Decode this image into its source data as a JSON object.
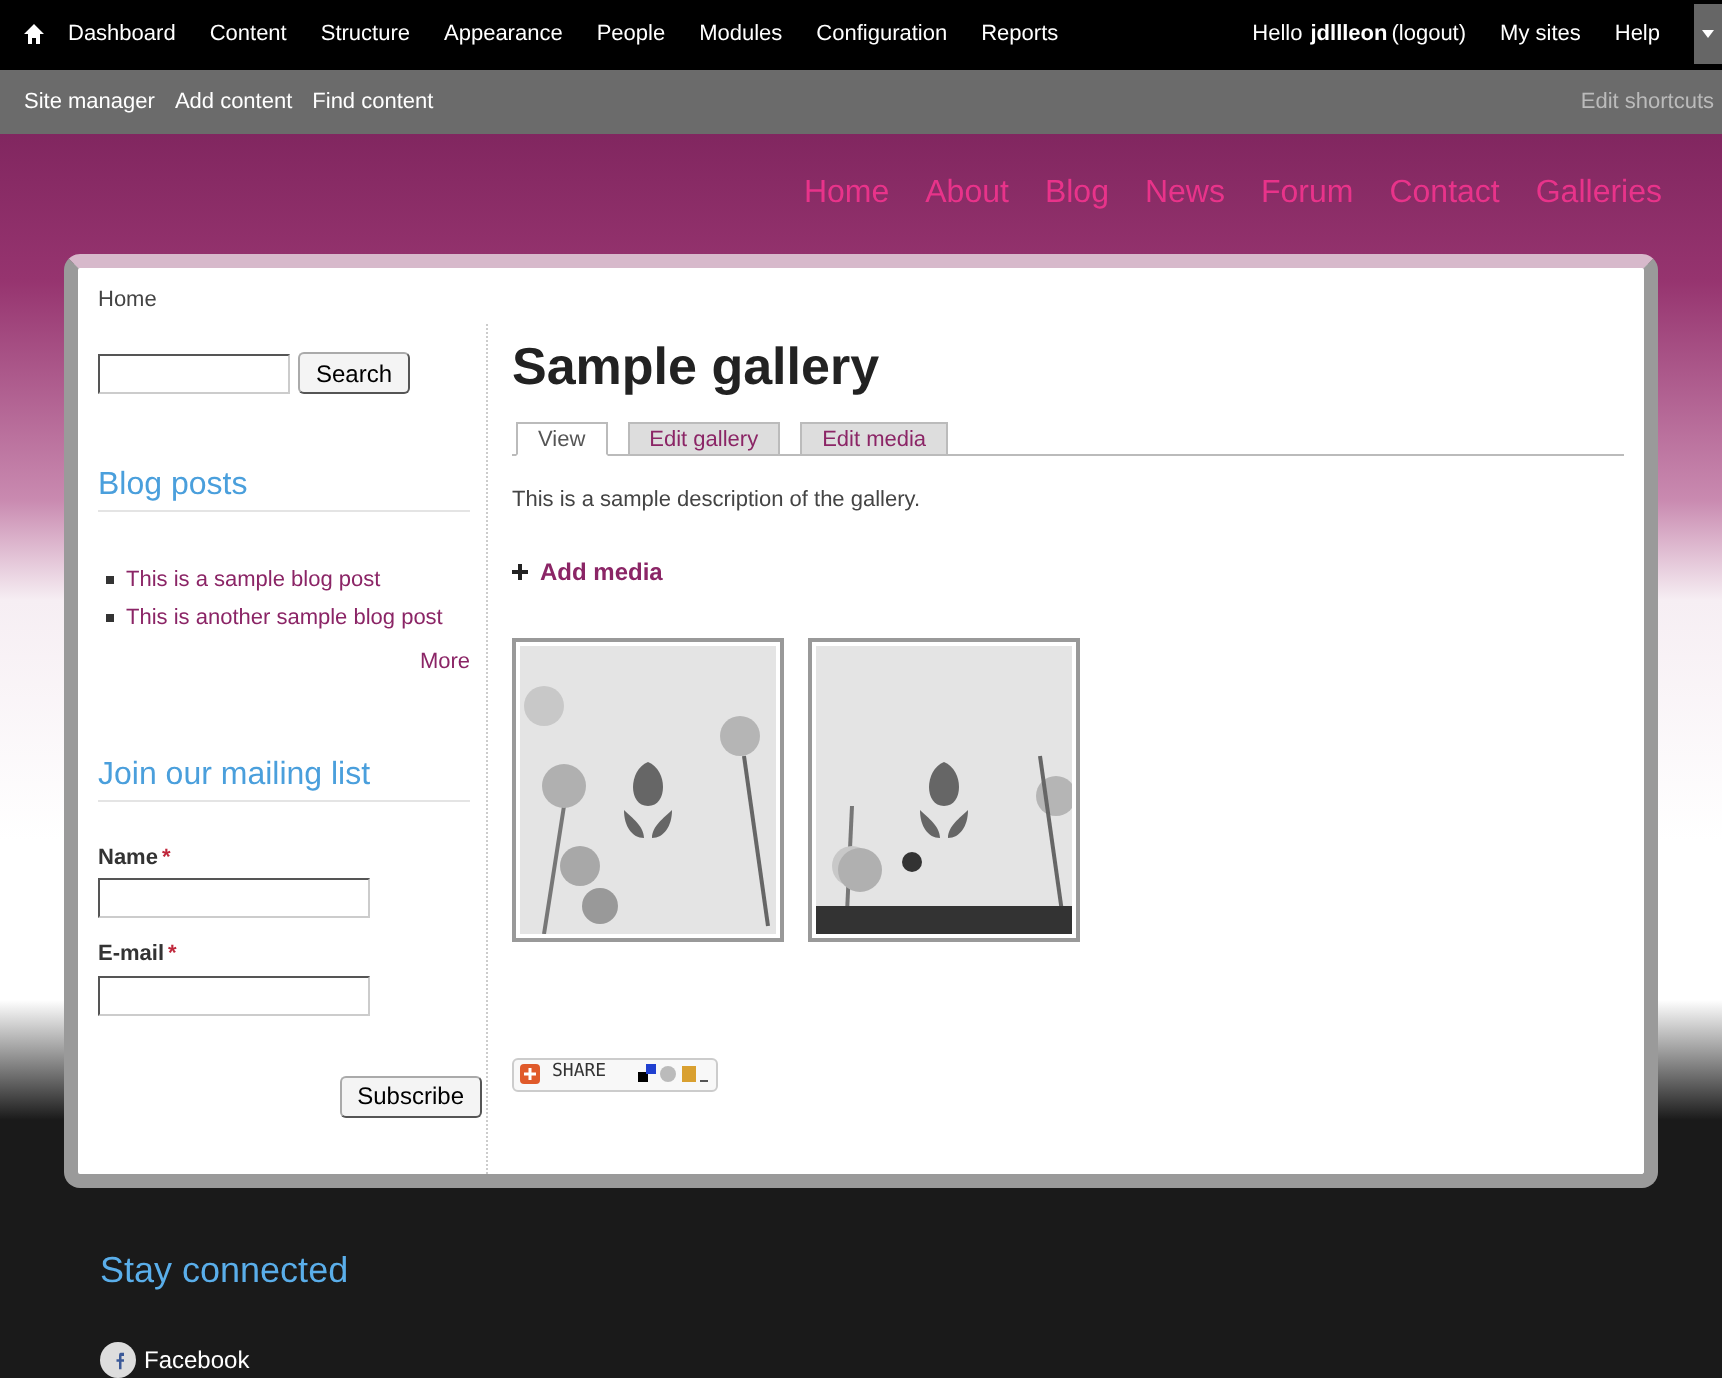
{
  "toolbar": {
    "menu": [
      "Dashboard",
      "Content",
      "Structure",
      "Appearance",
      "People",
      "Modules",
      "Configuration",
      "Reports"
    ],
    "greeting": "Hello",
    "username": "jdllleon",
    "logout": "(logout)",
    "links": [
      "My sites",
      "Help"
    ]
  },
  "shortcuts": {
    "items": [
      "Site manager",
      "Add content",
      "Find content"
    ],
    "edit": "Edit shortcuts"
  },
  "nav": [
    "Home",
    "About",
    "Blog",
    "News",
    "Forum",
    "Contact",
    "Galleries"
  ],
  "breadcrumb": "Home",
  "search": {
    "button": "Search"
  },
  "blog_block": {
    "title": "Blog posts",
    "items": [
      "This is a sample blog post",
      "This is another sample blog post"
    ],
    "more": "More"
  },
  "mailing_block": {
    "title": "Join our mailing list",
    "fields": [
      {
        "label": "Name",
        "required_mark": "*"
      },
      {
        "label": "E-mail",
        "required_mark": "*"
      }
    ],
    "button": "Subscribe"
  },
  "page": {
    "title": "Sample gallery",
    "tabs": [
      {
        "label": "View",
        "selected": true
      },
      {
        "label": "Edit gallery",
        "selected": false
      },
      {
        "label": "Edit media",
        "selected": false
      }
    ],
    "description": "This is a sample description of the gallery.",
    "add_media": "Add media",
    "share": "SHARE"
  },
  "footer": {
    "title": "Stay connected",
    "links": [
      "Facebook"
    ]
  }
}
